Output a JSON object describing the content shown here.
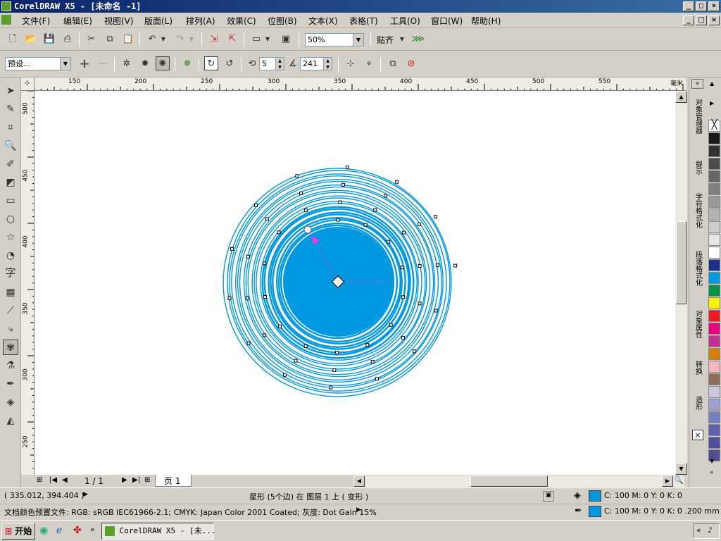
{
  "window": {
    "title": "CorelDRAW X5 - [未命名 -1]",
    "buttons": [
      "_",
      "□",
      "×"
    ]
  },
  "menu": [
    "文件(F)",
    "编辑(E)",
    "视图(V)",
    "版面(L)",
    "排列(A)",
    "效果(C)",
    "位图(B)",
    "文本(X)",
    "表格(T)",
    "工具(O)",
    "窗口(W)",
    "帮助(H)"
  ],
  "toolbar": {
    "zoom_value": "50%",
    "snap_label": "贴齐"
  },
  "property_bar": {
    "preset": "预设...",
    "plus": "+",
    "minus": "−",
    "points_value": "5",
    "sharpness_value": "241"
  },
  "ruler": {
    "unit": "毫米",
    "h_labels": [
      "150",
      "200",
      "250",
      "300",
      "350",
      "400",
      "450",
      "500",
      "550"
    ],
    "v_labels": [
      "500",
      "450",
      "400",
      "350",
      "300",
      "250"
    ]
  },
  "dockers": [
    "对象管理器",
    "提示",
    "字符格式化",
    "段落格式化",
    "对象属性",
    "转换",
    "造形"
  ],
  "palette_colors": [
    "#ffffff",
    "#1a1a1a",
    "#333333",
    "#4d4d4d",
    "#666666",
    "#808080",
    "#999999",
    "#b3b3b3",
    "#cccccc",
    "#e6e6e6",
    "#ffffff",
    "#1b2f8c",
    "#0098e0",
    "#00944a",
    "#fff200",
    "#ed1c24",
    "#e6007e",
    "#c2318f",
    "#d97e00",
    "#f4b6c2",
    "#8c6e5a",
    "#c8c8e0",
    "#a0a0d0",
    "#7080c0",
    "#6060b0",
    "#5050a0",
    "#505090"
  ],
  "page_nav": {
    "counter": "1 / 1",
    "page_tab": "页 1"
  },
  "status": {
    "coords": "( 335.012, 394.404 )",
    "object_info": "星形 (5个边) 在 图层 1 上 ( 变形 )",
    "fill_info": "C: 100 M: 0 Y: 0 K: 0",
    "outline_info": "C: 100 M: 0 Y: 0 K: 0  .200 mm",
    "color_profile": "文档颜色预置文件: RGB: sRGB IEC61966-2.1; CMYK: Japan Color 2001 Coated; 灰度: Dot Gain 15%",
    "fill_color": "#0098e0",
    "outline_color": "#0098e0"
  },
  "taskbar": {
    "start": "开始",
    "task_label": "CorelDRAW X5 - [未..."
  },
  "colors": {
    "shape_color": "#0098e0",
    "title_bar": "#0a246a"
  }
}
